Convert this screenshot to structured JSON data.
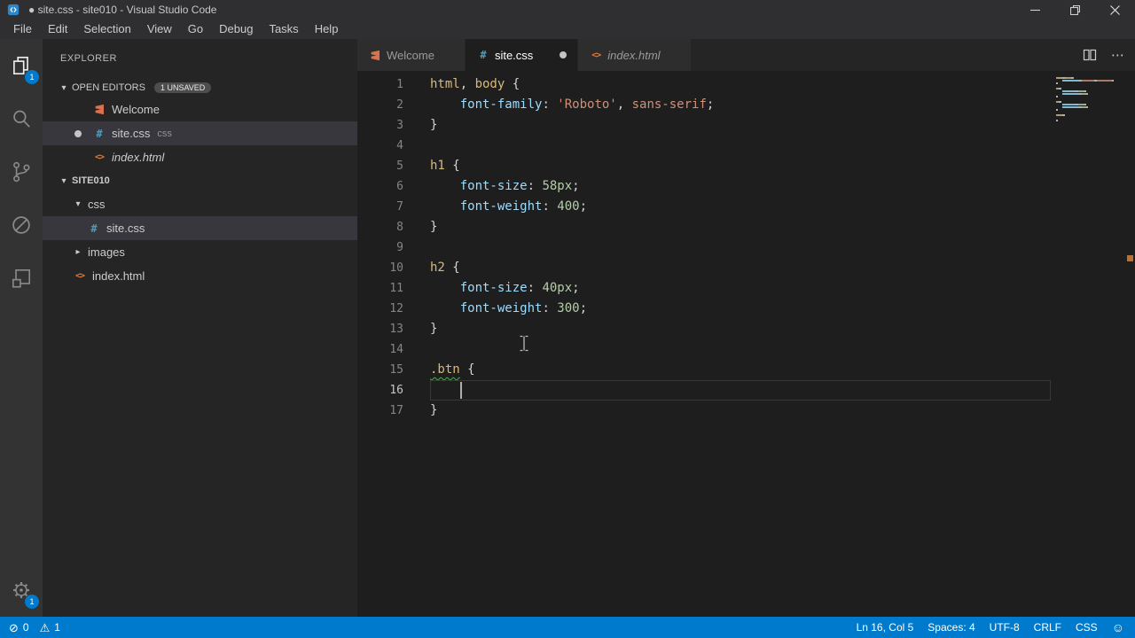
{
  "window": {
    "title": "● site.css - site010 - Visual Studio Code"
  },
  "menu": {
    "items": [
      "File",
      "Edit",
      "Selection",
      "View",
      "Go",
      "Debug",
      "Tasks",
      "Help"
    ]
  },
  "activity_bar": {
    "explorer_badge": "1",
    "settings_badge": "1"
  },
  "sidebar": {
    "header": "EXPLORER",
    "open_editors_label": "OPEN EDITORS",
    "unsaved_badge": "1 UNSAVED",
    "root_label": "SITE010",
    "open_editors": [
      {
        "label": "Welcome",
        "icon": "welcome"
      },
      {
        "label": "site.css",
        "icon": "css",
        "detail": "css",
        "modified": true,
        "selected": true
      },
      {
        "label": "index.html",
        "icon": "html",
        "italic": true
      }
    ],
    "tree": [
      {
        "label": "css",
        "type": "folder",
        "expanded": true,
        "indent": 1
      },
      {
        "label": "site.css",
        "type": "css",
        "indent": 2,
        "selected": true
      },
      {
        "label": "images",
        "type": "folder",
        "expanded": false,
        "indent": 1
      },
      {
        "label": "index.html",
        "type": "html",
        "indent": 1
      }
    ]
  },
  "tabs": {
    "items": [
      {
        "label": "Welcome",
        "icon": "welcome"
      },
      {
        "label": "site.css",
        "icon": "css",
        "active": true,
        "modified": true
      },
      {
        "label": "index.html",
        "icon": "html",
        "italic": true
      }
    ]
  },
  "editor": {
    "lines": [
      {
        "n": 1,
        "tokens": [
          [
            "html",
            "sel"
          ],
          [
            ", ",
            "pun"
          ],
          [
            "body",
            "sel"
          ],
          [
            " {",
            "pun"
          ]
        ]
      },
      {
        "n": 2,
        "tokens": [
          [
            "    ",
            "pun"
          ],
          [
            "font-family",
            "prop"
          ],
          [
            ": ",
            "pun"
          ],
          [
            "'Roboto'",
            "str"
          ],
          [
            ", ",
            "pun"
          ],
          [
            "sans-serif",
            "val"
          ],
          [
            ";",
            "pun"
          ]
        ]
      },
      {
        "n": 3,
        "tokens": [
          [
            "}",
            "pun"
          ]
        ]
      },
      {
        "n": 4,
        "tokens": []
      },
      {
        "n": 5,
        "tokens": [
          [
            "h1",
            "sel"
          ],
          [
            " {",
            "pun"
          ]
        ]
      },
      {
        "n": 6,
        "tokens": [
          [
            "    ",
            "pun"
          ],
          [
            "font-size",
            "prop"
          ],
          [
            ": ",
            "pun"
          ],
          [
            "58px",
            "num"
          ],
          [
            ";",
            "pun"
          ]
        ]
      },
      {
        "n": 7,
        "tokens": [
          [
            "    ",
            "pun"
          ],
          [
            "font-weight",
            "prop"
          ],
          [
            ": ",
            "pun"
          ],
          [
            "400",
            "num"
          ],
          [
            ";",
            "pun"
          ]
        ]
      },
      {
        "n": 8,
        "tokens": [
          [
            "}",
            "pun"
          ]
        ]
      },
      {
        "n": 9,
        "tokens": []
      },
      {
        "n": 10,
        "tokens": [
          [
            "h2",
            "sel"
          ],
          [
            " {",
            "pun"
          ]
        ]
      },
      {
        "n": 11,
        "tokens": [
          [
            "    ",
            "pun"
          ],
          [
            "font-size",
            "prop"
          ],
          [
            ": ",
            "pun"
          ],
          [
            "40px",
            "num"
          ],
          [
            ";",
            "pun"
          ]
        ]
      },
      {
        "n": 12,
        "tokens": [
          [
            "    ",
            "pun"
          ],
          [
            "font-weight",
            "prop"
          ],
          [
            ": ",
            "pun"
          ],
          [
            "300",
            "num"
          ],
          [
            ";",
            "pun"
          ]
        ]
      },
      {
        "n": 13,
        "tokens": [
          [
            "}",
            "pun"
          ]
        ]
      },
      {
        "n": 14,
        "tokens": []
      },
      {
        "n": 15,
        "tokens": [
          [
            ".btn",
            "sel",
            true
          ],
          [
            " {",
            "pun"
          ]
        ]
      },
      {
        "n": 16,
        "tokens": [
          [
            "    ",
            "pun"
          ]
        ],
        "current": true,
        "cursor": true
      },
      {
        "n": 17,
        "tokens": [
          [
            "}",
            "pun"
          ]
        ]
      }
    ]
  },
  "status_bar": {
    "errors": "0",
    "warnings": "1",
    "right": [
      "Ln 16, Col 5",
      "Spaces: 4",
      "UTF-8",
      "CRLF",
      "CSS"
    ]
  },
  "colors": {
    "accent": "#007acc",
    "tokens": {
      "sel": "#d7ba7d",
      "pun": "#d4d4d4",
      "prop": "#9cdcfe",
      "str": "#ce9178",
      "val": "#ce9178",
      "num": "#b5cea8"
    },
    "squiggle": "#4fae4f",
    "icon_css": "#519aba",
    "icon_html": "#e37933",
    "icon_welcome": "#d9734f",
    "modified_dot": "#c4c4c4"
  }
}
